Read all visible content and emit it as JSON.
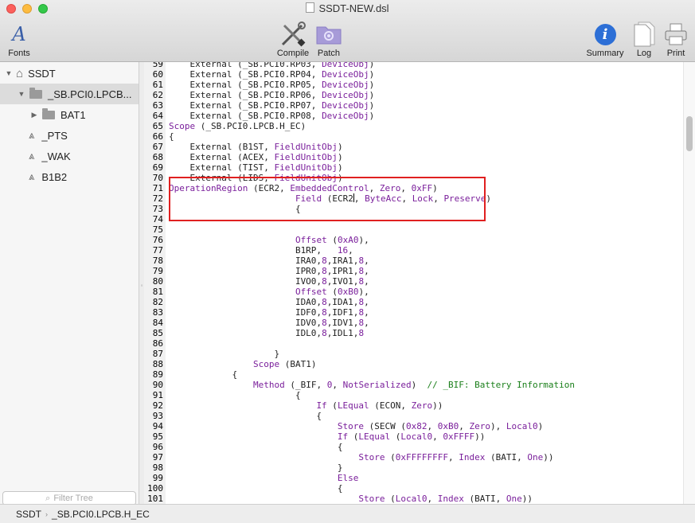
{
  "window": {
    "title": "SSDT-NEW.dsl"
  },
  "toolbar": {
    "fonts": "Fonts",
    "compile": "Compile",
    "patch": "Patch",
    "summary": "Summary",
    "log": "Log",
    "print": "Print"
  },
  "sidebar": {
    "items": [
      {
        "label": "SSDT"
      },
      {
        "label": "_SB.PCI0.LPCB..."
      },
      {
        "label": "BAT1"
      },
      {
        "label": "_PTS"
      },
      {
        "label": "_WAK"
      },
      {
        "label": "B1B2"
      }
    ],
    "filter_placeholder": "Filter Tree"
  },
  "status": {
    "crumb1": "SSDT",
    "crumb2": "_SB.PCI0.LPCB.H_EC"
  },
  "accent_colors": {
    "keyword": "#7a1f9b",
    "comment": "#1a7f1a",
    "highlight_box": "#e02020"
  },
  "code_lines": [
    {
      "n": "59",
      "segs": [
        [
          "    External (_SB.PCI0.RP03, ",
          ""
        ],
        [
          "DeviceObj",
          "k"
        ],
        [
          ")",
          ""
        ]
      ]
    },
    {
      "n": "60",
      "segs": [
        [
          "    External (_SB.PCI0.RP04, ",
          ""
        ],
        [
          "DeviceObj",
          "k"
        ],
        [
          ")",
          ""
        ]
      ]
    },
    {
      "n": "61",
      "segs": [
        [
          "    External (_SB.PCI0.RP05, ",
          ""
        ],
        [
          "DeviceObj",
          "k"
        ],
        [
          ")",
          ""
        ]
      ]
    },
    {
      "n": "62",
      "segs": [
        [
          "    External (_SB.PCI0.RP06, ",
          ""
        ],
        [
          "DeviceObj",
          "k"
        ],
        [
          ")",
          ""
        ]
      ]
    },
    {
      "n": "63",
      "segs": [
        [
          "    External (_SB.PCI0.RP07, ",
          ""
        ],
        [
          "DeviceObj",
          "k"
        ],
        [
          ")",
          ""
        ]
      ]
    },
    {
      "n": "64",
      "segs": [
        [
          "    External (_SB.PCI0.RP08, ",
          ""
        ],
        [
          "DeviceObj",
          "k"
        ],
        [
          ")",
          ""
        ]
      ]
    },
    {
      "n": "65",
      "segs": [
        [
          "Scope",
          "k"
        ],
        [
          " (_SB.PCI0.LPCB.H_EC)",
          ""
        ]
      ]
    },
    {
      "n": "66",
      "segs": [
        [
          "{",
          ""
        ]
      ]
    },
    {
      "n": "67",
      "segs": [
        [
          "    External (B1ST, ",
          ""
        ],
        [
          "FieldUnitObj",
          "k"
        ],
        [
          ")",
          ""
        ]
      ]
    },
    {
      "n": "68",
      "segs": [
        [
          "    External (ACEX, ",
          ""
        ],
        [
          "FieldUnitObj",
          "k"
        ],
        [
          ")",
          ""
        ]
      ]
    },
    {
      "n": "69",
      "segs": [
        [
          "    External (TIST, ",
          ""
        ],
        [
          "FieldUnitObj",
          "k"
        ],
        [
          ")",
          ""
        ]
      ]
    },
    {
      "n": "70",
      "segs": [
        [
          "    External (LIDS, ",
          ""
        ],
        [
          "FieldUnitObj",
          "k"
        ],
        [
          ")",
          ""
        ]
      ]
    },
    {
      "n": "71",
      "segs": [
        [
          "OperationRegion",
          "k"
        ],
        [
          " (ECR2, ",
          ""
        ],
        [
          "EmbeddedControl",
          "k"
        ],
        [
          ", ",
          ""
        ],
        [
          "Zero",
          "k"
        ],
        [
          ", ",
          ""
        ],
        [
          "0xFF",
          "k"
        ],
        [
          ")",
          ""
        ]
      ]
    },
    {
      "n": "72",
      "segs": [
        [
          "                        ",
          ""
        ],
        [
          "Field",
          "k"
        ],
        [
          " (ECR2",
          ""
        ],
        [
          "|",
          "cur"
        ],
        [
          ", ",
          ""
        ],
        [
          "ByteAcc",
          "k"
        ],
        [
          ", ",
          ""
        ],
        [
          "Lock",
          "k"
        ],
        [
          ", ",
          ""
        ],
        [
          "Preserve",
          "k"
        ],
        [
          ")",
          ""
        ]
      ]
    },
    {
      "n": "73",
      "segs": [
        [
          "                        {",
          ""
        ]
      ]
    },
    {
      "n": "74",
      "segs": []
    },
    {
      "n": "75",
      "segs": []
    },
    {
      "n": "76",
      "segs": [
        [
          "                        ",
          ""
        ],
        [
          "Offset",
          "k"
        ],
        [
          " (",
          ""
        ],
        [
          "0xA0",
          "k"
        ],
        [
          "),",
          ""
        ]
      ]
    },
    {
      "n": "77",
      "segs": [
        [
          "                        B1RP,   ",
          ""
        ],
        [
          "16",
          "k"
        ],
        [
          ",",
          ""
        ]
      ]
    },
    {
      "n": "78",
      "segs": [
        [
          "                        IRA0,",
          ""
        ],
        [
          "8",
          "k"
        ],
        [
          ",IRA1,",
          ""
        ],
        [
          "8",
          "k"
        ],
        [
          ",",
          ""
        ]
      ]
    },
    {
      "n": "79",
      "segs": [
        [
          "                        IPR0,",
          ""
        ],
        [
          "8",
          "k"
        ],
        [
          ",IPR1,",
          ""
        ],
        [
          "8",
          "k"
        ],
        [
          ",",
          ""
        ]
      ]
    },
    {
      "n": "80",
      "segs": [
        [
          "                        IVO0,",
          ""
        ],
        [
          "8",
          "k"
        ],
        [
          ",IVO1,",
          ""
        ],
        [
          "8",
          "k"
        ],
        [
          ",",
          ""
        ]
      ]
    },
    {
      "n": "81",
      "segs": [
        [
          "                        ",
          ""
        ],
        [
          "Offset",
          "k"
        ],
        [
          " (",
          ""
        ],
        [
          "0xB0",
          "k"
        ],
        [
          "),",
          ""
        ]
      ]
    },
    {
      "n": "82",
      "segs": [
        [
          "                        IDA0,",
          ""
        ],
        [
          "8",
          "k"
        ],
        [
          ",IDA1,",
          ""
        ],
        [
          "8",
          "k"
        ],
        [
          ",",
          ""
        ]
      ]
    },
    {
      "n": "83",
      "segs": [
        [
          "                        IDF0,",
          ""
        ],
        [
          "8",
          "k"
        ],
        [
          ",IDF1,",
          ""
        ],
        [
          "8",
          "k"
        ],
        [
          ",",
          ""
        ]
      ]
    },
    {
      "n": "84",
      "segs": [
        [
          "                        IDV0,",
          ""
        ],
        [
          "8",
          "k"
        ],
        [
          ",IDV1,",
          ""
        ],
        [
          "8",
          "k"
        ],
        [
          ",",
          ""
        ]
      ]
    },
    {
      "n": "85",
      "segs": [
        [
          "                        IDL0,",
          ""
        ],
        [
          "8",
          "k"
        ],
        [
          ",IDL1,",
          ""
        ],
        [
          "8",
          "k"
        ]
      ]
    },
    {
      "n": "86",
      "segs": []
    },
    {
      "n": "87",
      "segs": [
        [
          "                    }",
          ""
        ]
      ]
    },
    {
      "n": "88",
      "segs": [
        [
          "                ",
          ""
        ],
        [
          "Scope",
          "k"
        ],
        [
          " (BAT1)",
          ""
        ]
      ]
    },
    {
      "n": "89",
      "segs": [
        [
          "            {",
          ""
        ]
      ]
    },
    {
      "n": "90",
      "segs": [
        [
          "                ",
          ""
        ],
        [
          "Method",
          "k"
        ],
        [
          " (_BIF, ",
          ""
        ],
        [
          "0",
          "k"
        ],
        [
          ", ",
          ""
        ],
        [
          "NotSerialized",
          "k"
        ],
        [
          ")  ",
          ""
        ],
        [
          "// _BIF: Battery Information",
          "g"
        ]
      ]
    },
    {
      "n": "91",
      "segs": [
        [
          "                        {",
          ""
        ]
      ]
    },
    {
      "n": "92",
      "segs": [
        [
          "                            ",
          ""
        ],
        [
          "If",
          "k"
        ],
        [
          " (",
          ""
        ],
        [
          "LEqual",
          "k"
        ],
        [
          " (ECON, ",
          ""
        ],
        [
          "Zero",
          "k"
        ],
        [
          "))",
          ""
        ]
      ]
    },
    {
      "n": "93",
      "segs": [
        [
          "                            {",
          ""
        ]
      ]
    },
    {
      "n": "94",
      "segs": [
        [
          "                                ",
          ""
        ],
        [
          "Store",
          "k"
        ],
        [
          " (SECW (",
          ""
        ],
        [
          "0x82",
          "k"
        ],
        [
          ", ",
          ""
        ],
        [
          "0xB0",
          "k"
        ],
        [
          ", ",
          ""
        ],
        [
          "Zero",
          "k"
        ],
        [
          "), ",
          ""
        ],
        [
          "Local0",
          "k"
        ],
        [
          ")",
          ""
        ]
      ]
    },
    {
      "n": "95",
      "segs": [
        [
          "                                ",
          ""
        ],
        [
          "If",
          "k"
        ],
        [
          " (",
          ""
        ],
        [
          "LEqual",
          "k"
        ],
        [
          " (",
          ""
        ],
        [
          "Local0",
          "k"
        ],
        [
          ", ",
          ""
        ],
        [
          "0xFFFF",
          "k"
        ],
        [
          "))",
          ""
        ]
      ]
    },
    {
      "n": "96",
      "segs": [
        [
          "                                {",
          ""
        ]
      ]
    },
    {
      "n": "97",
      "segs": [
        [
          "                                    ",
          ""
        ],
        [
          "Store",
          "k"
        ],
        [
          " (",
          ""
        ],
        [
          "0xFFFFFFFF",
          "k"
        ],
        [
          ", ",
          ""
        ],
        [
          "Index",
          "k"
        ],
        [
          " (BATI, ",
          ""
        ],
        [
          "One",
          "k"
        ],
        [
          "))",
          ""
        ]
      ]
    },
    {
      "n": "98",
      "segs": [
        [
          "                                }",
          ""
        ]
      ]
    },
    {
      "n": "99",
      "segs": [
        [
          "                                ",
          ""
        ],
        [
          "Else",
          "k"
        ]
      ]
    },
    {
      "n": "100",
      "segs": [
        [
          "                                {",
          ""
        ]
      ]
    },
    {
      "n": "101",
      "segs": [
        [
          "                                    ",
          ""
        ],
        [
          "Store",
          "k"
        ],
        [
          " (",
          ""
        ],
        [
          "Local0",
          "k"
        ],
        [
          ", ",
          ""
        ],
        [
          "Index",
          "k"
        ],
        [
          " (BATI, ",
          ""
        ],
        [
          "One",
          "k"
        ],
        [
          "))",
          ""
        ]
      ]
    },
    {
      "n": "102",
      "segs": [
        [
          "                                }",
          ""
        ]
      ]
    }
  ]
}
